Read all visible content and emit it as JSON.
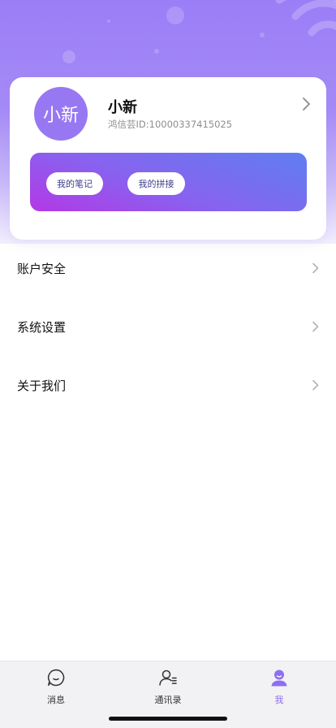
{
  "profile": {
    "avatar_text": "小新",
    "name": "小新",
    "id_text": "鸿信芸ID:10000337415025"
  },
  "banner": {
    "notes_label": "我的笔记",
    "splice_label": "我的拼接"
  },
  "menu": {
    "items": [
      {
        "label": "账户安全"
      },
      {
        "label": "系统设置"
      },
      {
        "label": "关于我们"
      }
    ]
  },
  "tabbar": {
    "tabs": [
      {
        "label": "消息",
        "icon": "chat-icon"
      },
      {
        "label": "通讯录",
        "icon": "contacts-icon"
      },
      {
        "label": "我",
        "icon": "user-icon",
        "active": true
      }
    ]
  },
  "colors": {
    "accent": "#8d6ff0",
    "avatar_bg": "#9878f2",
    "banner_start": "#b438e6",
    "banner_end": "#5f7ef0"
  }
}
